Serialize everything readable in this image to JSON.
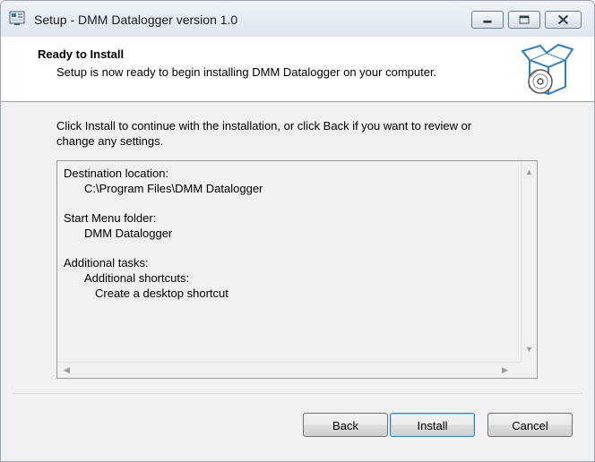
{
  "window": {
    "title": "Setup - DMM Datalogger version 1.0"
  },
  "header": {
    "title": "Ready to Install",
    "subtitle": "Setup is now ready to begin installing DMM Datalogger on your computer."
  },
  "intro": {
    "line1": "Click Install to continue with the installation, or click Back if you want to review or",
    "line2": "change any settings."
  },
  "memo": {
    "destination_label": "Destination location:",
    "destination_value": "C:\\Program Files\\DMM Datalogger",
    "start_menu_label": "Start Menu folder:",
    "start_menu_value": "DMM Datalogger",
    "tasks_label": "Additional tasks:",
    "tasks_group": "Additional shortcuts:",
    "tasks_item": "Create a desktop shortcut"
  },
  "buttons": {
    "back": "Back",
    "install": "Install",
    "cancel": "Cancel"
  }
}
